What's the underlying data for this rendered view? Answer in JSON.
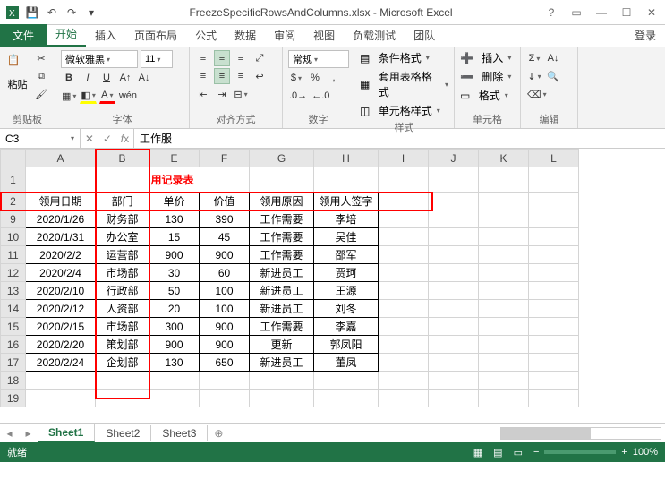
{
  "title": "FreezeSpecificRowsAndColumns.xlsx - Microsoft Excel",
  "tabs": {
    "file": "文件",
    "home": "开始",
    "insert": "插入",
    "layout": "页面布局",
    "formula": "公式",
    "data": "数据",
    "review": "审阅",
    "view": "视图",
    "load": "负载测试",
    "team": "团队",
    "login": "登录"
  },
  "ribbon": {
    "clipboard": {
      "paste": "粘贴",
      "label": "剪贴板"
    },
    "font": {
      "name": "微软雅黑",
      "size": "11",
      "label": "字体"
    },
    "align": {
      "label": "对齐方式"
    },
    "number": {
      "general": "常规",
      "label": "数字"
    },
    "styles": {
      "cond": "条件格式",
      "table": "套用表格格式",
      "cell": "单元格样式",
      "label": "样式"
    },
    "cells": {
      "insert": "插入",
      "delete": "删除",
      "format": "格式",
      "label": "单元格"
    },
    "editing": {
      "label": "编辑"
    }
  },
  "namebox": "C3",
  "fxvalue": "工作服",
  "colheaders": [
    "A",
    "B",
    "E",
    "F",
    "G",
    "H",
    "I",
    "J",
    "K",
    "L"
  ],
  "title_frag": "用记录表",
  "headrow": [
    "领用日期",
    "部门",
    "单价",
    "价值",
    "领用原因",
    "领用人签字"
  ],
  "rows": [
    {
      "n": "9",
      "d": [
        "2020/1/26",
        "财务部",
        "130",
        "390",
        "工作需要",
        "李培"
      ]
    },
    {
      "n": "10",
      "d": [
        "2020/1/31",
        "办公室",
        "15",
        "45",
        "工作需要",
        "吴佳"
      ]
    },
    {
      "n": "11",
      "d": [
        "2020/2/2",
        "运营部",
        "900",
        "900",
        "工作需要",
        "邵军"
      ]
    },
    {
      "n": "12",
      "d": [
        "2020/2/4",
        "市场部",
        "30",
        "60",
        "新进员工",
        "贾珂"
      ]
    },
    {
      "n": "13",
      "d": [
        "2020/2/10",
        "行政部",
        "50",
        "100",
        "新进员工",
        "王源"
      ]
    },
    {
      "n": "14",
      "d": [
        "2020/2/12",
        "人资部",
        "20",
        "100",
        "新进员工",
        "刘冬"
      ]
    },
    {
      "n": "15",
      "d": [
        "2020/2/15",
        "市场部",
        "300",
        "900",
        "工作需要",
        "李嘉"
      ]
    },
    {
      "n": "16",
      "d": [
        "2020/2/20",
        "策划部",
        "900",
        "900",
        "更新",
        "郭凤阳"
      ]
    },
    {
      "n": "17",
      "d": [
        "2020/2/24",
        "企划部",
        "130",
        "650",
        "新进员工",
        "董凤"
      ]
    }
  ],
  "emptyrows": [
    "18",
    "19"
  ],
  "sheets": [
    "Sheet1",
    "Sheet2",
    "Sheet3"
  ],
  "status": "就绪",
  "zoom": "100%"
}
